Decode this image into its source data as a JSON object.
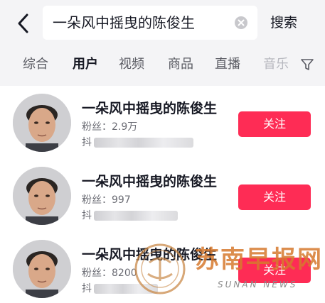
{
  "search": {
    "query": "一朵风中摇曳的陈俊生",
    "button_label": "搜索"
  },
  "tabs": [
    {
      "label": "综合",
      "active": false
    },
    {
      "label": "用户",
      "active": true
    },
    {
      "label": "视频",
      "active": false
    },
    {
      "label": "商品",
      "active": false
    },
    {
      "label": "直播",
      "active": false
    },
    {
      "label": "音乐",
      "active": false
    }
  ],
  "results": [
    {
      "name": "一朵风中摇曳的陈俊生",
      "fans": "粉丝：2.9万",
      "id_prefix": "抖",
      "follow_label": "关注"
    },
    {
      "name": "一朵风中摇曳的陈俊生",
      "fans": "粉丝：997",
      "id_prefix": "抖",
      "follow_label": "关注"
    },
    {
      "name": "一朵风中摇曳的陈俊生",
      "fans": "粉丝：8200",
      "id_prefix": "抖",
      "follow_label": "关注"
    }
  ],
  "watermark": {
    "text": "苏南早报网",
    "sub": "SUNAN NEWS"
  },
  "colors": {
    "accent": "#fe2c55",
    "header_bg": "#f4f4f6",
    "watermark": "#d77a2e"
  },
  "icons": [
    "back-arrow-icon",
    "clear-icon",
    "filter-icon"
  ]
}
